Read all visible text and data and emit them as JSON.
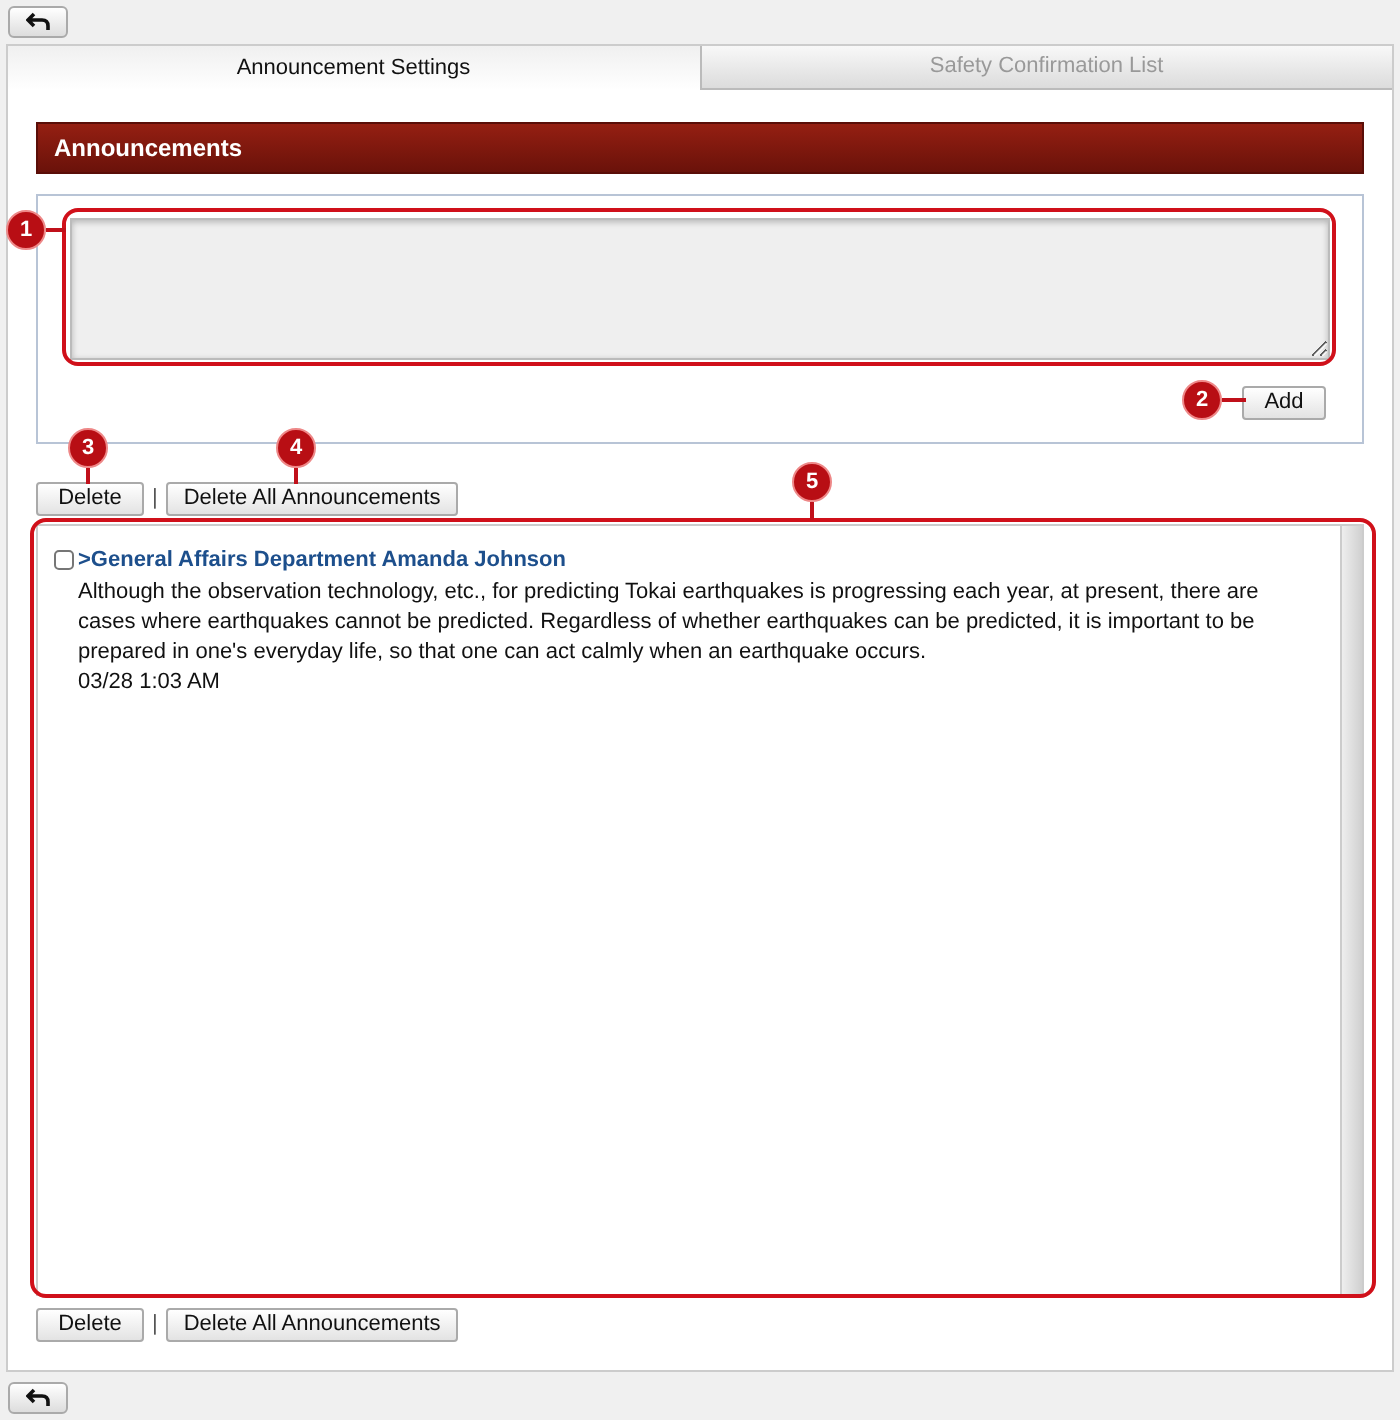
{
  "tabs": [
    {
      "label": "Announcement Settings",
      "selected": true
    },
    {
      "label": "Safety Confirmation List",
      "selected": false
    }
  ],
  "header": "Announcements",
  "add_button": "Add",
  "top_actions": {
    "delete_button": "Delete",
    "separator": "|",
    "delete_all_button": "Delete All Announcements"
  },
  "bottom_actions": {
    "delete_button": "Delete",
    "separator": "|",
    "delete_all_button": "Delete All Announcements"
  },
  "announcements": [
    {
      "checked": false,
      "sender": ">General Affairs Department Amanda Johnson",
      "body": "Although the observation technology, etc., for predicting Tokai earthquakes is progressing each year, at present, there are cases where earthquakes cannot be predicted. Regardless of whether earthquakes can be predicted, it is important to be prepared in one's everyday life, so that one can act calmly when an earthquake occurs.",
      "time": "03/28 1:03 AM"
    }
  ],
  "callouts": [
    {
      "label": "1"
    },
    {
      "label": "2"
    },
    {
      "label": "3"
    },
    {
      "label": "4"
    },
    {
      "label": "5"
    }
  ]
}
